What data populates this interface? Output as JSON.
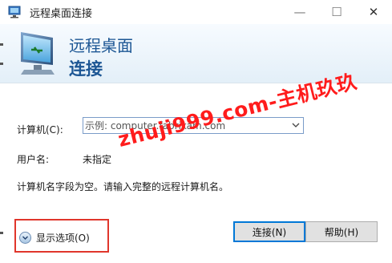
{
  "window": {
    "title": "远程桌面连接",
    "min_glyph": "—",
    "max_glyph": "☐",
    "close_glyph": "✕"
  },
  "header": {
    "subtitle": "远程桌面",
    "title": "连接"
  },
  "form": {
    "computer_label": "计算机(C):",
    "computer_placeholder": "示例: computer.fabrikam.com",
    "user_label": "用户名:",
    "user_value": "未指定",
    "hint": "计算机名字段为空。请输入完整的远程计算机名。"
  },
  "footer": {
    "show_options": "显示选项(O)",
    "connect": "连接(N)",
    "help": "帮助(H)"
  },
  "watermark": "zhuji999.com-主机玖玖",
  "colors": {
    "header_text": "#1c5694",
    "watermark": "#ff1c1c",
    "highlight_box": "#e0362c",
    "default_button_border": "#0078d7"
  }
}
